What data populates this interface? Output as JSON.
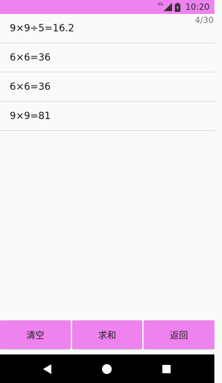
{
  "status_bar": {
    "network_label": "4G",
    "time": "10:20",
    "color": "#ee82ee"
  },
  "counter": "4/30",
  "records": [
    "9×9÷5=16.2",
    "6×6=36",
    "6×6=36",
    "9×9=81"
  ],
  "buttons": {
    "clear": "清空",
    "sum": "求和",
    "back": "返回"
  },
  "nav": {
    "back_icon": "triangle-back-icon",
    "home_icon": "circle-home-icon",
    "recents_icon": "square-recents-icon"
  },
  "colors": {
    "accent": "#ee82ee",
    "nav_bar": "#000000"
  }
}
